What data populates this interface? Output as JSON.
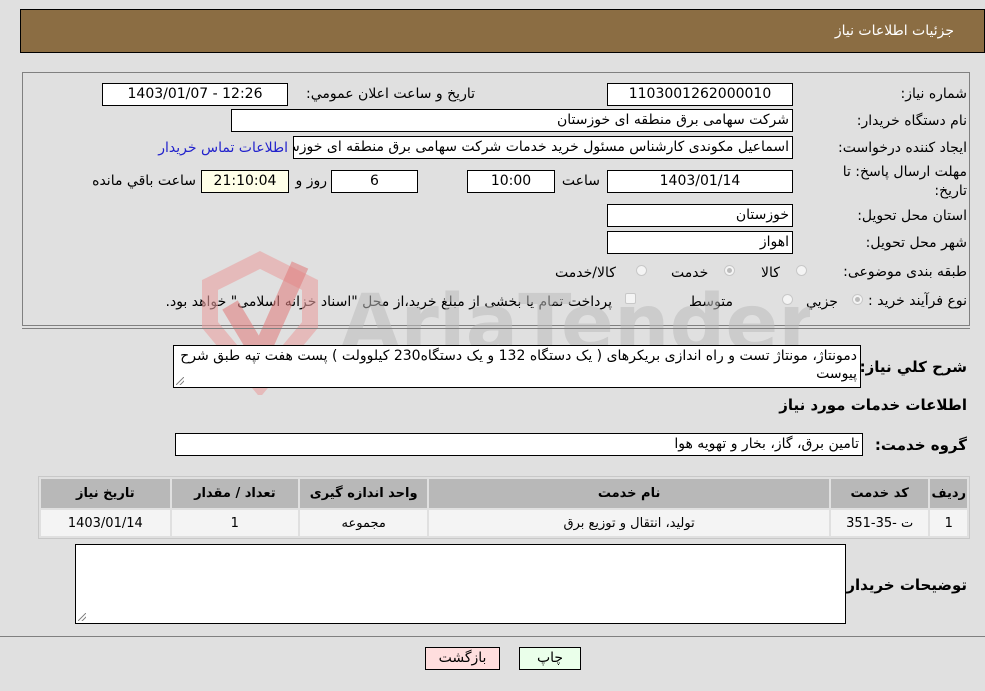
{
  "header": {
    "title": "جزئیات اطلاعات نیاز"
  },
  "form": {
    "need_number": {
      "label": "شماره نیاز:",
      "value": "1103001262000010"
    },
    "announce_datetime": {
      "label": "تاریخ و ساعت اعلان عمومي:",
      "value": "1403/01/07 - 12:26"
    },
    "buyer_org": {
      "label": "نام دستگاه خريدار:",
      "value": "شرکت سهامی برق منطقه ای خوزستان"
    },
    "requester": {
      "label": "ایجاد کننده درخواست:",
      "value": "اسماعیل مکوندی کارشناس مسئول خرید خدمات شرکت سهامی برق منطقه ای خوزستان",
      "contact_link": "اطلاعات تماس خريدار"
    },
    "deadline": {
      "label": "مهلت ارسال پاسخ: تا تاریخ:",
      "date": "1403/01/14",
      "time_label": "ساعت",
      "time": "10:00",
      "days": "6",
      "days_label": "روز و",
      "remaining": "21:10:04",
      "remaining_label": "ساعت باقي مانده"
    },
    "province": {
      "label": "استان محل تحویل:",
      "value": "خوزستان"
    },
    "city": {
      "label": "شهر محل تحویل:",
      "value": "اهواز"
    },
    "category": {
      "label": "طبقه بندی موضوعی:",
      "options": [
        "کالا",
        "خدمت",
        "کالا/خدمت"
      ],
      "selected": "خدمت"
    },
    "process": {
      "label": "نوع فرآیند خرید :",
      "options": [
        "جزيي",
        "متوسط"
      ],
      "selected": "جزيي",
      "treasury_note": "پرداخت تمام یا بخشی از مبلغ خرید،از محل \"اسناد خزانه اسلامی\" خواهد بود."
    }
  },
  "description": {
    "label": "شرح کلي نياز:",
    "value": "دمونتاژ، مونتاژ تست و راه اندازی بریکرهای ( یک دستگاه 132 و  یک دستگاه230 کیلوولت ) پست هفت تپه طبق شرح پیوست"
  },
  "services": {
    "section_title": "اطلاعات خدمات مورد نياز",
    "group_label": "گروه خدمت:",
    "group_value": "تامین برق، گاز، بخار و تهویه هوا",
    "table": {
      "headers": [
        "رديف",
        "کد خدمت",
        "نام خدمت",
        "واحد اندازه گيری",
        "تعداد / مقدار",
        "تاريخ نياز"
      ],
      "rows": [
        [
          "1",
          "ت -35-351",
          "تولید، انتقال و توزیع برق",
          "مجموعه",
          "1",
          "1403/01/14"
        ]
      ]
    }
  },
  "buyer_notes": {
    "label": "توضيحات خريدار:",
    "value": ""
  },
  "buttons": {
    "print": "چاپ",
    "back": "بازگشت"
  },
  "watermark": {
    "text": "AriaTender.neT"
  },
  "colors": {
    "header_bg": "#8b6d43",
    "print_bg": "#eaffea",
    "back_bg": "#ffdede",
    "link": "#2222cc"
  }
}
